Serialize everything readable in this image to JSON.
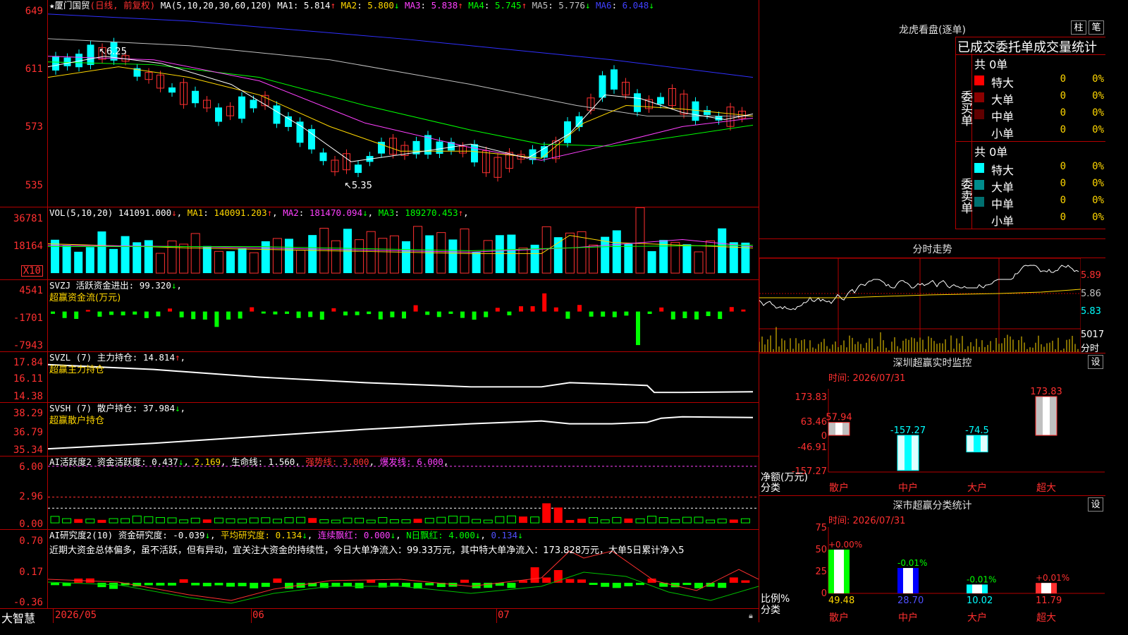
{
  "stock": {
    "name": "厦门国贸",
    "mode": "(日线, 前复权)"
  },
  "ma": {
    "label": "MA(5,10,20,30,60,120)",
    "items": [
      {
        "name": "MA1",
        "value": "5.814",
        "arrow": "↑",
        "color": "#ffffff"
      },
      {
        "name": "MA2",
        "value": "5.800",
        "arrow": "↓",
        "color": "#ffd700"
      },
      {
        "name": "MA3",
        "value": "5.838",
        "arrow": "↑",
        "color": "#ff40ff"
      },
      {
        "name": "MA4",
        "value": "5.745",
        "arrow": "↑",
        "color": "#00ff00"
      },
      {
        "name": "MA5",
        "value": "5.776",
        "arrow": "↓",
        "color": "#c0c0c0"
      },
      {
        "name": "MA6",
        "value": "6.048",
        "arrow": "↓",
        "color": "#4040ff"
      }
    ]
  },
  "price_axis": [
    "649",
    "611",
    "573",
    "535"
  ],
  "annotations": {
    "high": "6.25",
    "low": "5.35"
  },
  "vol": {
    "label": "VOL(5,10,20)",
    "value": "141091.000",
    "arrow": "↓",
    "items": [
      {
        "name": "MA1",
        "value": "140091.203",
        "arrow": "↑",
        "color": "#ffd700"
      },
      {
        "name": "MA2",
        "value": "181470.094",
        "arrow": "↓",
        "color": "#ff40ff"
      },
      {
        "name": "MA3",
        "value": "189270.453",
        "arrow": "↑",
        "color": "#00ff00"
      }
    ],
    "axis": [
      "36781",
      "18164"
    ],
    "unit": "X10"
  },
  "svzj": {
    "label": "SVZJ",
    "title": "活跃资金进出:",
    "value": "99.320",
    "arrow": "↓",
    "sub": "超赢资金流(万元)",
    "axis": [
      "4541",
      "-1701",
      "-7943"
    ]
  },
  "svzl": {
    "label": "SVZL (7)",
    "title": "主力持仓:",
    "value": "14.814",
    "arrow": "↑",
    "sub": "超赢主力持仓",
    "axis": [
      "17.84",
      "16.11",
      "14.38"
    ]
  },
  "svsh": {
    "label": "SVSH (7)",
    "title": "散户持仓:",
    "value": "37.984",
    "arrow": "↓",
    "sub": "超赢散户持仓",
    "axis": [
      "38.29",
      "36.79",
      "35.34"
    ]
  },
  "ai1": {
    "label": "AI活跃度2",
    "t1": "资金活跃度:",
    "v1": "0.437",
    "a1": "↓",
    "v2": "2.169",
    "t3": "生命线:",
    "v3": "1.560",
    "t4": "强势线:",
    "v4": "3.000",
    "t5": "爆发线:",
    "v5": "6.000",
    "axis": [
      "6.00",
      "2.96",
      "0.00"
    ]
  },
  "ai2": {
    "label": "AI研究度2(10)",
    "t1": "资金研究度:",
    "v1": "-0.039",
    "a1": "↓",
    "t2": "平均研究度:",
    "v2": "0.134",
    "a2": "↓",
    "t3": "连续飘红:",
    "v3": "0.000",
    "a3": "↓",
    "t4": "N日飘红:",
    "v4": "4.000",
    "a4": "↓",
    "v5": "0.134",
    "a5": "↓",
    "comment": "近期大资金总体偏多，虽不活跃，但有异动，宜关注大资金的持续性，今日大单净流入：99.33万元，其中特大单净流入：173.828万元，大单5日累计净入5",
    "axis": [
      "0.70",
      "0.17",
      "-0.36"
    ]
  },
  "xaxis": {
    "brand": "大智慧",
    "labels": [
      "2026/05",
      "06",
      "07"
    ]
  },
  "dragon": {
    "title": "龙虎看盘(逐单)",
    "btn1": "柱",
    "btn2": "笔",
    "subtitle": "已成交委托单成交量统计",
    "buy": {
      "label": "委买单",
      "total": "共 0单",
      "rows": [
        {
          "name": "特大",
          "v": "0",
          "p": "0%",
          "color": "#ff0000"
        },
        {
          "name": "大单",
          "v": "0",
          "p": "0%",
          "color": "#8b0000"
        },
        {
          "name": "中单",
          "v": "0",
          "p": "0%",
          "color": "#600000"
        },
        {
          "name": "小单",
          "v": "0",
          "p": "0%",
          "color": "#000000"
        }
      ]
    },
    "sell": {
      "label": "委卖单",
      "total": "共 0单",
      "rows": [
        {
          "name": "特大",
          "v": "0",
          "p": "0%",
          "color": "#00ffff"
        },
        {
          "name": "大单",
          "v": "0",
          "p": "0%",
          "color": "#008b8b"
        },
        {
          "name": "中单",
          "v": "0",
          "p": "0%",
          "color": "#007070"
        },
        {
          "name": "小单",
          "v": "0",
          "p": "0%",
          "color": "#000000"
        }
      ]
    }
  },
  "intraday": {
    "title": "分时走势",
    "axis": [
      "5.89",
      "5.86",
      "5.83"
    ],
    "vol_value": "5017",
    "vol_label": "分时"
  },
  "sz_monitor": {
    "title": "深圳超赢实时监控",
    "btn": "设",
    "time": "时间: 2026/07/31",
    "axis": [
      "173.83",
      "63.46",
      "0",
      "-46.91",
      "-157.27"
    ],
    "ylabel": "净额(万元)",
    "xlabel": "分类",
    "chart_data": {
      "type": "bar",
      "categories": [
        "散户",
        "中户",
        "大户",
        "超大"
      ],
      "values": [
        57.94,
        -157.27,
        -74.5,
        173.83
      ],
      "labels": [
        "57.94",
        "-157.27",
        "-74.5",
        "173.83"
      ],
      "ylim": [
        -157.27,
        173.83
      ],
      "ylabel": "净额(万元)",
      "xlabel": "分类"
    }
  },
  "sz_stats": {
    "title": "深市超赢分类统计",
    "btn": "设",
    "time": "时间: 2026/07/31",
    "axis": [
      "75",
      "50",
      "25",
      "0"
    ],
    "ylabel": "比例%",
    "xlabel": "分类",
    "chart_data": {
      "type": "bar",
      "categories": [
        "散户",
        "中户",
        "大户",
        "超大"
      ],
      "values": [
        49.48,
        28.7,
        10.02,
        11.79
      ],
      "changes": [
        "+0.00%",
        "-0.01%",
        "-0.01%",
        "+0.01%"
      ],
      "ylim": [
        0,
        75
      ],
      "ylabel": "比例%",
      "xlabel": "分类"
    }
  }
}
